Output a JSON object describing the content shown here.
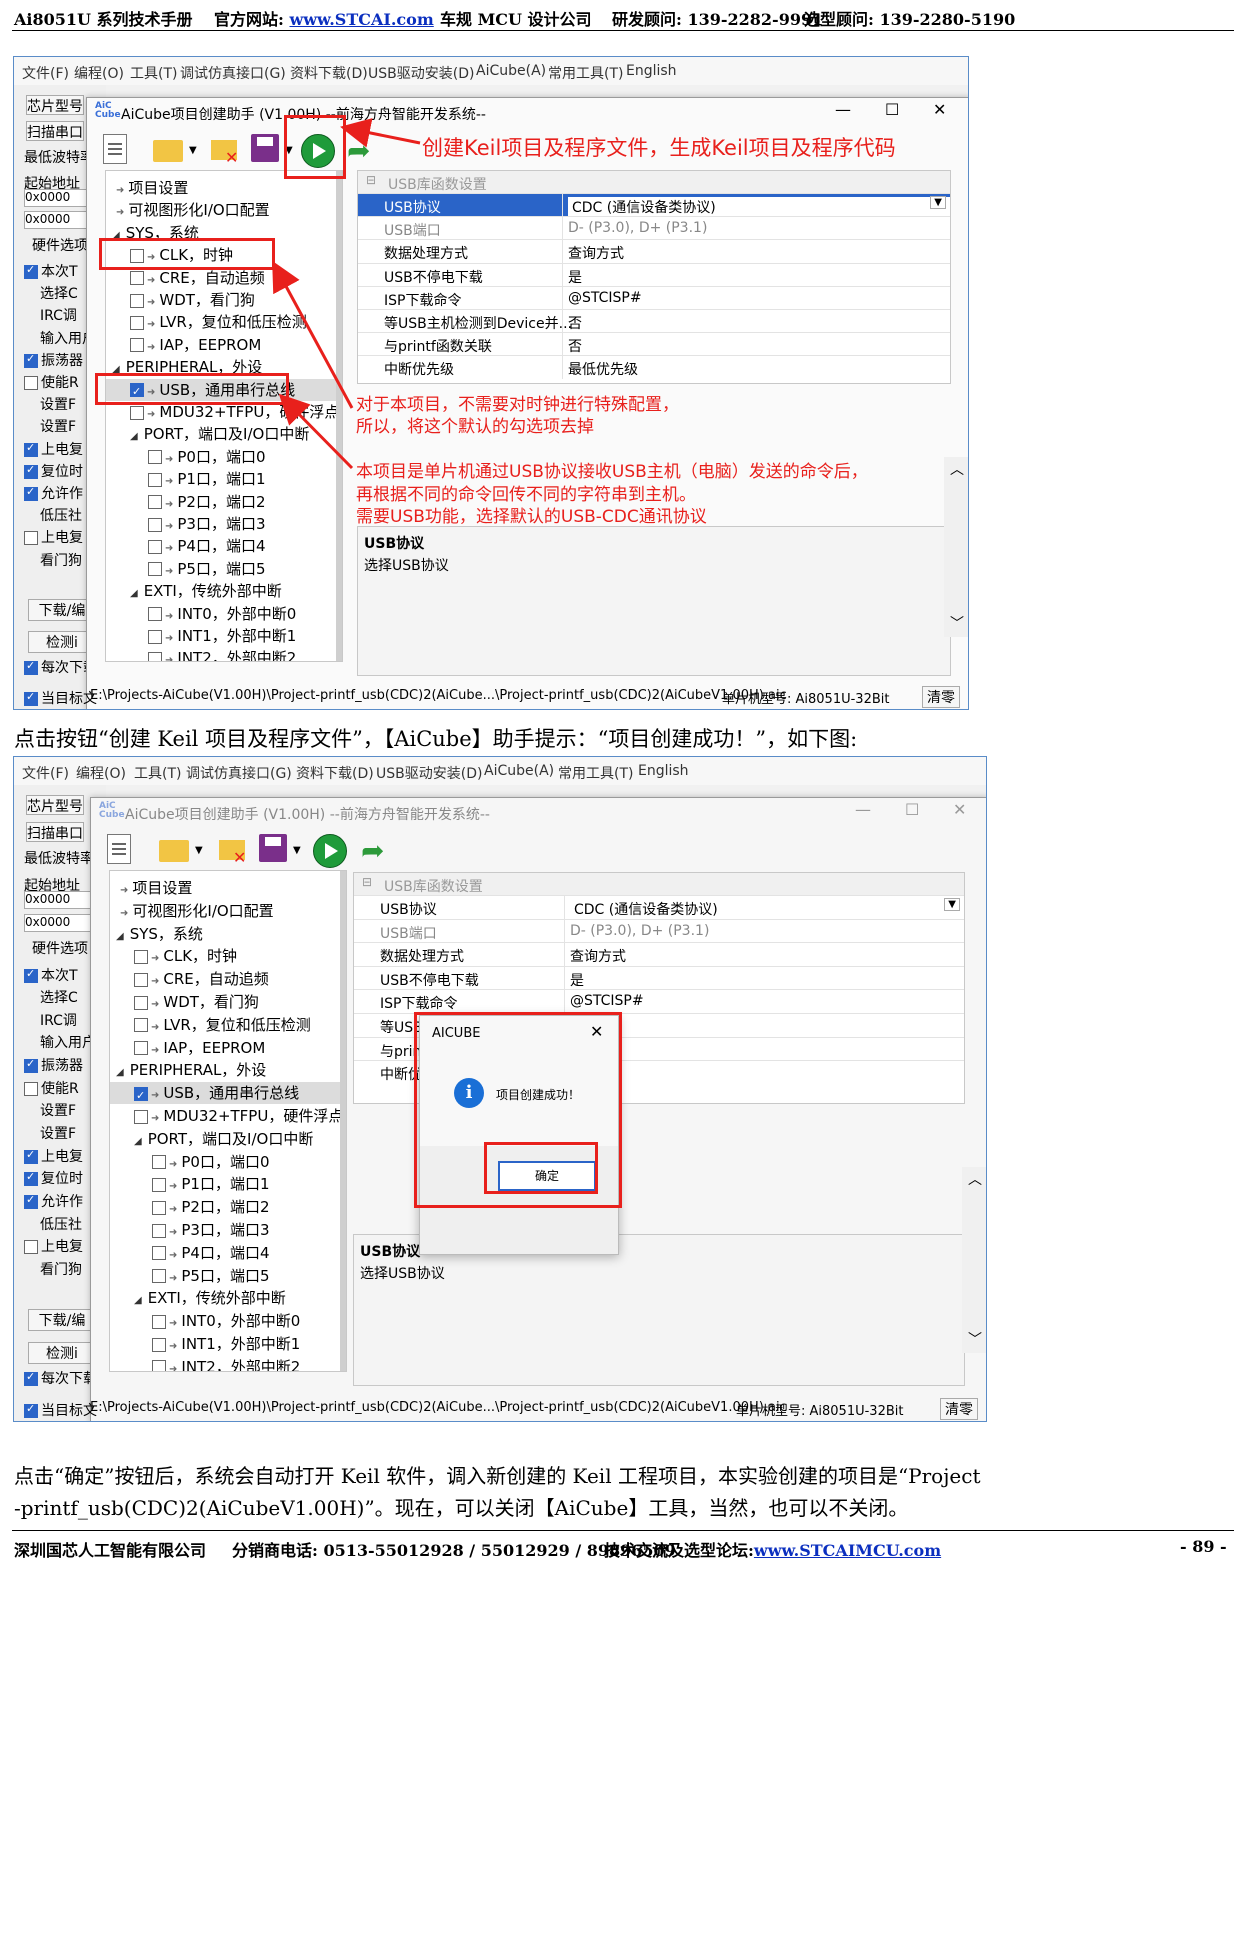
{
  "header": {
    "manual": "Ai8051U 系列技术手册",
    "site_label": "官方网站: ",
    "site_url": "www.STCAI.com",
    "company": "车规 MCU 设计公司",
    "rd_contact": "研发顾问: 139-2282-9991",
    "sel_contact": "选型顾问: 139-2280-5190"
  },
  "ide": {
    "menu": [
      "文件(F)",
      "编程(O)",
      "工具(T)",
      "调试仿真接口(G)",
      "资料下载(D)",
      "USB驱动安装(D)",
      "AiCube(A)",
      "常用工具(T)",
      "English"
    ],
    "left": {
      "chip": "芯片型号",
      "scan": "扫描串口",
      "baud": "最低波特率",
      "start_addr": "起始地址",
      "addr1": "0x0000",
      "addr2": "0x0000",
      "hw": "硬件选项",
      "opts": [
        "本次T",
        "选择C",
        "IRC调",
        "输入用户",
        "振荡器",
        "使能R",
        "设置F",
        "设置F",
        "上电复",
        "复位时",
        "允许作",
        "低压社",
        "上电复",
        "看门狗"
      ],
      "download": "下载/编",
      "detect": "检测i",
      "each": "每次下载",
      "current": "当目标文"
    },
    "status_path": "E:\\Projects-AiCube(V1.00H)\\Project-printf_usb(CDC)2(AiCube...\\Project-printf_usb(CDC)2(AiCubeV1.00H).aic",
    "status_chip": "单片机型号: Ai8051U-32Bit",
    "clear": "清零"
  },
  "dialog": {
    "title": "AiCube项目创建助手 (V1.00H) --前海方舟智能开发系统--",
    "logo": "AiC Cube",
    "tree": [
      {
        "label": "项目设置",
        "indent": 0,
        "kind": "leaf"
      },
      {
        "label": "可视图形化I/O口配置",
        "indent": 0,
        "kind": "leaf"
      },
      {
        "label": "SYS，系统",
        "indent": 0,
        "kind": "group"
      },
      {
        "label": "CLK，时钟",
        "indent": 1,
        "kind": "check",
        "checked": false
      },
      {
        "label": "CRE，自动追频",
        "indent": 1,
        "kind": "check",
        "checked": false
      },
      {
        "label": "WDT，看门狗",
        "indent": 1,
        "kind": "check",
        "checked": false
      },
      {
        "label": "LVR，复位和低压检测",
        "indent": 1,
        "kind": "check",
        "checked": false
      },
      {
        "label": "IAP，EEPROM",
        "indent": 1,
        "kind": "check",
        "checked": false
      },
      {
        "label": "PERIPHERAL，外设",
        "indent": 0,
        "kind": "group"
      },
      {
        "label": "USB，通用串行总线",
        "indent": 1,
        "kind": "check",
        "checked": true,
        "selected": true
      },
      {
        "label": "MDU32+TFPU，硬件浮点三",
        "indent": 1,
        "kind": "check",
        "checked": false
      },
      {
        "label": "PORT，端口及I/O口中断",
        "indent": 1,
        "kind": "group"
      },
      {
        "label": "P0口，端口0",
        "indent": 2,
        "kind": "check",
        "checked": false
      },
      {
        "label": "P1口，端口1",
        "indent": 2,
        "kind": "check",
        "checked": false
      },
      {
        "label": "P2口，端口2",
        "indent": 2,
        "kind": "check",
        "checked": false
      },
      {
        "label": "P3口，端口3",
        "indent": 2,
        "kind": "check",
        "checked": false
      },
      {
        "label": "P4口，端口4",
        "indent": 2,
        "kind": "check",
        "checked": false
      },
      {
        "label": "P5口，端口5",
        "indent": 2,
        "kind": "check",
        "checked": false
      },
      {
        "label": "EXTI，传统外部中断",
        "indent": 1,
        "kind": "group"
      },
      {
        "label": "INT0，外部中断0",
        "indent": 2,
        "kind": "check",
        "checked": false
      },
      {
        "label": "INT1，外部中断1",
        "indent": 2,
        "kind": "check",
        "checked": false
      },
      {
        "label": "INT2，外部中断2",
        "indent": 2,
        "kind": "check",
        "checked": false
      }
    ],
    "grid_header": "USB库函数设置",
    "grid": [
      {
        "k": "USB协议",
        "v": "CDC (通信设备类协议)"
      },
      {
        "k": "USB端口",
        "v": "D- (P3.0), D+ (P3.1)"
      },
      {
        "k": "数据处理方式",
        "v": "查询方式"
      },
      {
        "k": "USB不停电下载",
        "v": "是"
      },
      {
        "k": "ISP下载命令",
        "v": "@STCISP#"
      },
      {
        "k": "等USB主机检测到Device并...",
        "v": "否"
      },
      {
        "k": "与printf函数关联",
        "v": "否"
      },
      {
        "k": "中断优先级",
        "v": "最低优先级"
      }
    ],
    "desc_title": "USB协议",
    "desc_text": "选择USB协议"
  },
  "notes": {
    "create": "创建Keil项目及程序文件，生成Keil项目及程序代码",
    "clk1": "对于本项目，不需要对时钟进行特殊配置，",
    "clk2": "所以，将这个默认的勾选项去掉",
    "usb1": "本项目是单片机通过USB协议接收USB主机（电脑）发送的命令后，",
    "usb2": "再根据不同的命令回传不同的字符串到主机。",
    "usb3": "需要USB功能，选择默认的USB-CDC通讯协议"
  },
  "body": {
    "p1": "点击按钮“创建 Keil 项目及程序文件”，【AiCube】助手提示：“项目创建成功！”，如下图:",
    "p2a": "点击“确定”按钮后，系统会自动打开 Keil 软件，调入新创建的 Keil 工程项目，本实验创建的项目是“Project",
    "p2b": "-printf_usb(CDC)2(AiCubeV1.00H)”。现在，可以关闭【AiCube】工具，当然，也可以不关闭。"
  },
  "msgbox": {
    "title": "AICUBE",
    "text": "项目创建成功！",
    "ok": "确定"
  },
  "second_grid_rows_visible": [
    "USB协议",
    "USB端口",
    "数据处理方式",
    "USB不停电下载",
    "ISP下载命令",
    "等USB",
    "与prin",
    "中断优"
  ],
  "second_grid_vals": [
    "CDC (通信设备类协议)",
    "D- (P3.0), D+ (P3.1)",
    "查询方式",
    "是",
    "@STCISP#",
    "",
    "",
    "先级"
  ],
  "footer": {
    "company": "深圳国芯人工智能有限公司",
    "phone": "分销商电话: 0513-55012928 / 55012929 / 89896509",
    "forum_label": "技术交流及选型论坛:",
    "forum_url": "www.STCAIMCU.com",
    "page": "- 89 -"
  },
  "colors": {
    "red": "#e8201c",
    "link": "#0b2fbf",
    "select_blue": "#2a64c8"
  }
}
